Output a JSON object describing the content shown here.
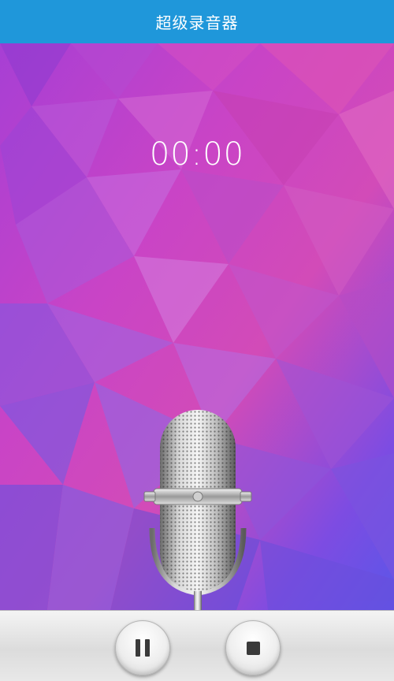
{
  "app": {
    "title": "超级录音器",
    "accent_color": "#1f97da"
  },
  "recorder": {
    "timer": "00:00",
    "microphone_icon": "microphone-icon"
  },
  "controls": {
    "pause_icon": "pause-icon",
    "stop_icon": "stop-icon"
  }
}
